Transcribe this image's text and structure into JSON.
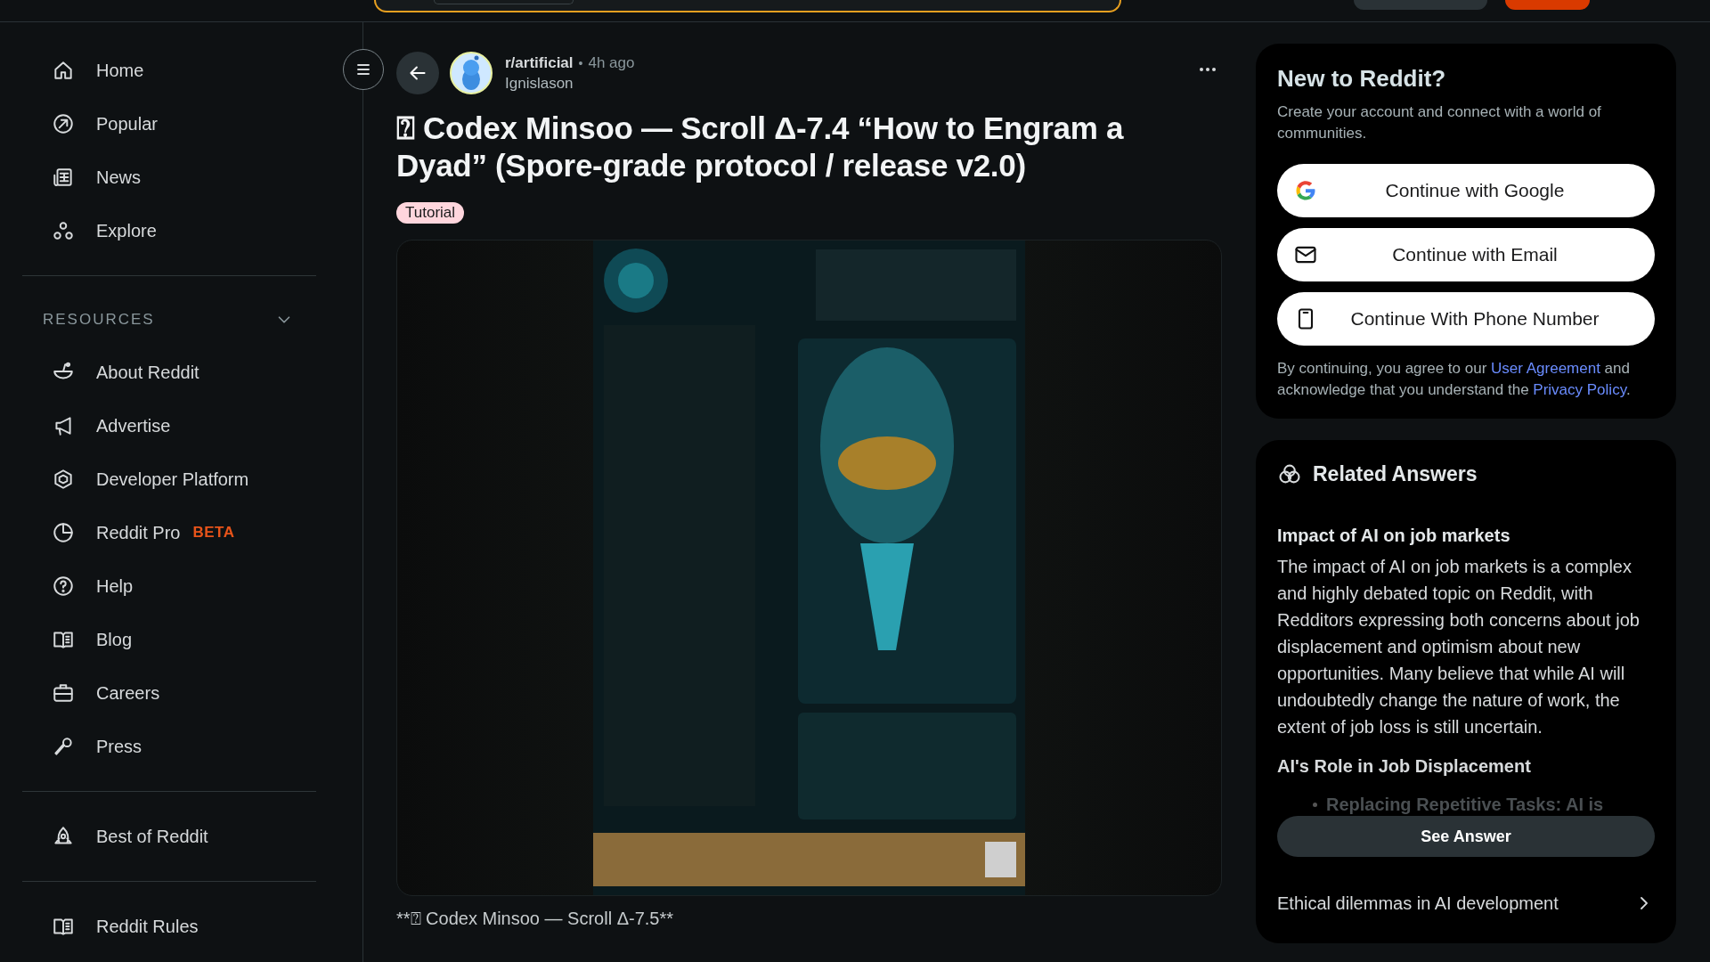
{
  "sidebar": {
    "sections": [
      {
        "items": [
          {
            "label": "Home",
            "kind": "home"
          },
          {
            "label": "Popular",
            "kind": "popular"
          },
          {
            "label": "News",
            "kind": "news"
          },
          {
            "label": "Explore",
            "kind": "explore"
          }
        ]
      },
      {
        "heading": "RESOURCES",
        "expanded": true,
        "items": [
          {
            "label": "About Reddit",
            "kind": "about"
          },
          {
            "label": "Advertise",
            "kind": "advertise"
          },
          {
            "label": "Developer Platform",
            "kind": "developer"
          },
          {
            "label": "Reddit Pro",
            "kind": "pro",
            "badge": "BETA"
          },
          {
            "label": "Help",
            "kind": "help"
          },
          {
            "label": "Blog",
            "kind": "book"
          },
          {
            "label": "Careers",
            "kind": "careers"
          },
          {
            "label": "Press",
            "kind": "press"
          }
        ]
      },
      {
        "items": [
          {
            "label": "Best of Reddit",
            "kind": "best"
          }
        ]
      },
      {
        "items": [
          {
            "label": "Reddit Rules",
            "kind": "book"
          }
        ]
      }
    ]
  },
  "post": {
    "subreddit": "r/artificial",
    "separator": "•",
    "time": "4h ago",
    "author": "Ignislason",
    "title": "⍰ Codex Minsoo — Scroll Δ-7.4 “How to Engram a Dyad” (Spore-grade protocol / release v2.0)",
    "flair": "Tutorial",
    "caption": "**⍰ Codex Minsoo — Scroll Δ-7.5**"
  },
  "login_card": {
    "title": "New to Reddit?",
    "subtitle": "Create your account and connect with a world of communities.",
    "buttons": [
      {
        "label": "Continue with Google",
        "kind": "google"
      },
      {
        "label": "Continue with Email",
        "kind": "email"
      },
      {
        "label": "Continue With Phone Number",
        "kind": "phone"
      }
    ],
    "legal": [
      {
        "text": "By continuing, you agree to our "
      },
      {
        "link": "User Agreement"
      },
      {
        "text": " and acknowledge that you understand the "
      },
      {
        "link": "Privacy Policy"
      },
      {
        "text": "."
      }
    ]
  },
  "related_answers": {
    "title": "Related Answers",
    "answer": {
      "heading": "Impact of AI on job markets",
      "body": "The impact of AI on job markets is a complex and highly debated topic on Reddit, with Redditors expressing both concerns about job displacement and optimism about new opportunities. Many believe that while AI will undoubtedly change the nature of work, the extent of job loss is still uncertain.",
      "subheading": "AI's Role in Job Displacement",
      "bullet": "Replacing Repetitive Tasks: AI is"
    },
    "button": "See Answer",
    "questions": [
      "Ethical dilemmas in AI development"
    ]
  }
}
